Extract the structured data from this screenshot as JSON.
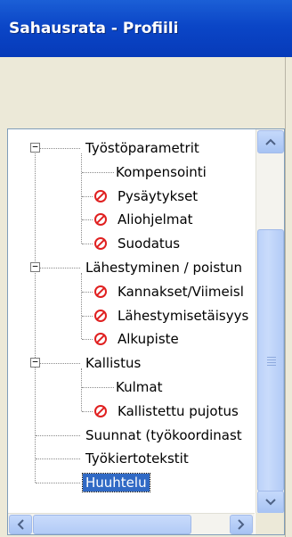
{
  "window": {
    "title": "Sahausrata - Profiili"
  },
  "tree": {
    "collapse_symbol": "−",
    "items": [
      {
        "label": "Työstöparametrit",
        "level": 0,
        "expander": true,
        "icon": ""
      },
      {
        "label": "Kompensointi",
        "level": 1,
        "expander": false,
        "icon": ""
      },
      {
        "label": "Pysäytykset",
        "level": 1,
        "expander": false,
        "icon": "prohibited-icon"
      },
      {
        "label": "Aliohjelmat",
        "level": 1,
        "expander": false,
        "icon": "prohibited-icon"
      },
      {
        "label": "Suodatus",
        "level": 1,
        "expander": false,
        "icon": "prohibited-icon"
      },
      {
        "label": "Lähestyminen / poistun",
        "level": 0,
        "expander": true,
        "icon": ""
      },
      {
        "label": "Kannakset/Viimeisl",
        "level": 1,
        "expander": false,
        "icon": "prohibited-icon"
      },
      {
        "label": "Lähestymisetäisyys",
        "level": 1,
        "expander": false,
        "icon": "prohibited-icon"
      },
      {
        "label": "Alkupiste",
        "level": 1,
        "expander": false,
        "icon": "prohibited-icon"
      },
      {
        "label": "Kallistus",
        "level": 0,
        "expander": true,
        "icon": ""
      },
      {
        "label": "Kulmat",
        "level": 1,
        "expander": false,
        "icon": ""
      },
      {
        "label": "Kallistettu pujotus",
        "level": 1,
        "expander": false,
        "icon": "prohibited-icon"
      },
      {
        "label": "Suunnat (työkoordinast",
        "level": 0,
        "expander": false,
        "icon": ""
      },
      {
        "label": "Työkiertotekstit",
        "level": 0,
        "expander": false,
        "icon": ""
      },
      {
        "label": "Huuhtelu",
        "level": 0,
        "expander": false,
        "icon": "",
        "selected": true
      }
    ]
  },
  "scrollbars": {
    "vertical": {
      "up": "scroll-up-arrow-icon",
      "down": "scroll-down-arrow-icon"
    },
    "horizontal": {
      "left": "scroll-left-arrow-icon",
      "right": "scroll-right-arrow-icon"
    }
  },
  "colors": {
    "titlebar": "#0b46c7",
    "selection": "#316ac5",
    "prohibited": "#e02020",
    "panel_bg": "#ece9d8"
  }
}
